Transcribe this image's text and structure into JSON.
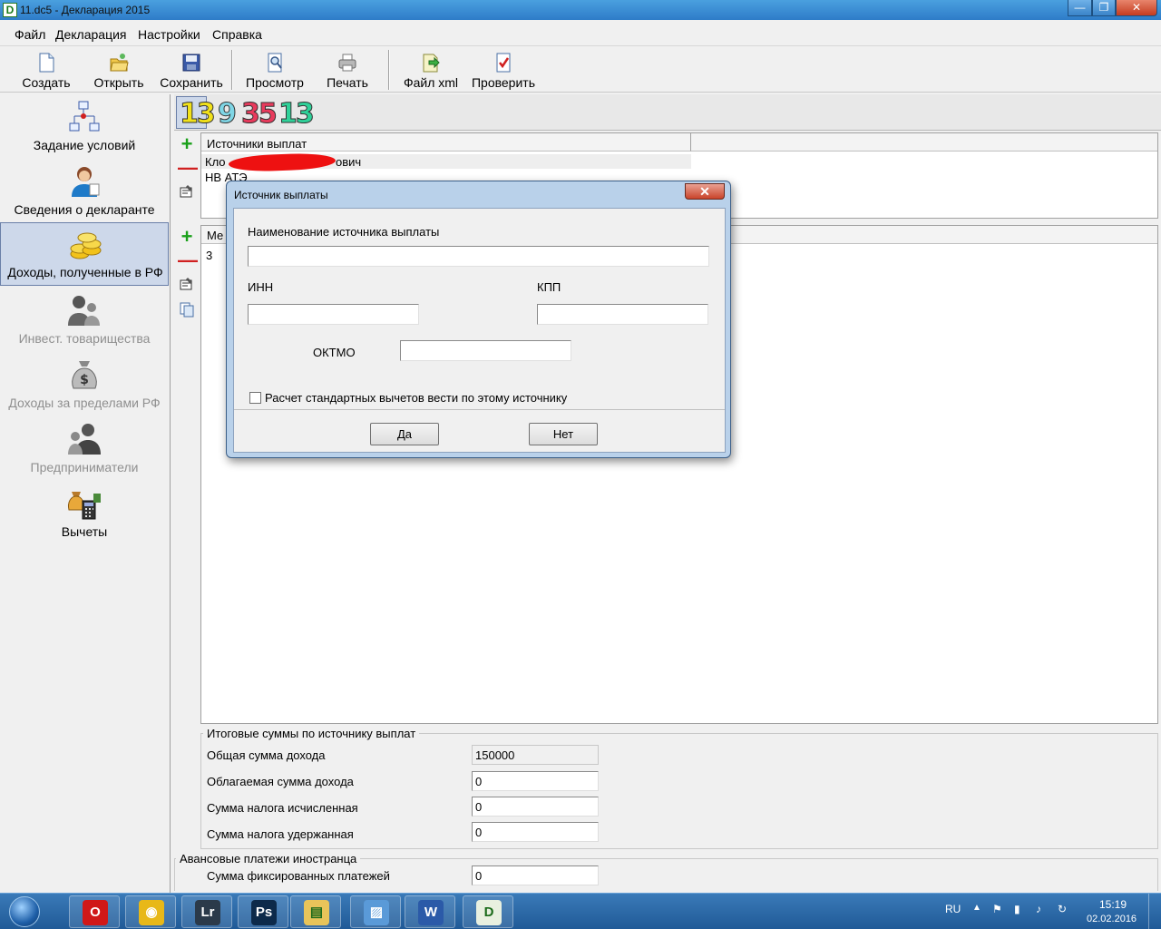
{
  "window": {
    "title": "11.dc5 - Декларация 2015",
    "app_icon": "D",
    "min_glyph": "—",
    "max_glyph": "❐",
    "close_glyph": "✕"
  },
  "menu": [
    "Файл",
    "Декларация",
    "Настройки",
    "Справка"
  ],
  "toolbar": {
    "create": "Создать",
    "open": "Открыть",
    "save": "Сохранить",
    "preview": "Просмотр",
    "print": "Печать",
    "xml": "Файл xml",
    "check": "Проверить"
  },
  "nav": {
    "conditions": "Задание условий",
    "declarant": "Сведения о декларанте",
    "income_rf": "Доходы, полученные в РФ",
    "invest": "Инвест. товарищества",
    "income_abroad": "Доходы за пределами РФ",
    "entrepreneurs": "Предприниматели",
    "deductions": "Вычеты"
  },
  "rates": [
    {
      "value": "13",
      "color": "#f2e21a"
    },
    {
      "value": "9",
      "color": "#7fd6e6"
    },
    {
      "value": "35",
      "color": "#e83a5c"
    },
    {
      "value": "13",
      "color": "#2fd199"
    }
  ],
  "sources": {
    "header": "Источники выплат",
    "rows": [
      "Кло",
      "ович",
      "НВ АТЭ"
    ]
  },
  "months": {
    "header": "Ме",
    "row1": "3"
  },
  "totals": {
    "title": "Итоговые суммы по источнику выплат",
    "total_income_label": "Общая сумма дохода",
    "total_income": "150000",
    "taxable_label": "Облагаемая сумма дохода",
    "taxable": "0",
    "tax_calc_label": "Сумма налога исчисленная",
    "tax_calc": "0",
    "tax_withheld_label": "Сумма налога удержанная",
    "tax_withheld": "0"
  },
  "advance": {
    "title": "Авансовые платежи иностранца",
    "fixed_label": "Сумма фиксированных платежей",
    "fixed": "0"
  },
  "dialog": {
    "title": "Источник выплаты",
    "close_glyph": "✕",
    "name_label": "Наименование источника выплаты",
    "name_value": "",
    "inn_label": "ИНН",
    "inn_value": "",
    "kpp_label": "КПП",
    "kpp_value": "",
    "oktmo_label": "ОКТМО",
    "oktmo_value": "",
    "std_deductions_label": "Расчет стандартных вычетов вести по этому источнику",
    "std_deductions_checked": false,
    "ok": "Да",
    "cancel": "Нет"
  },
  "taskbar": {
    "apps": [
      {
        "name": "opera-icon",
        "glyph": "O",
        "color": "#d01818"
      },
      {
        "name": "chrome-icon",
        "glyph": "◉",
        "color": "#e8b818"
      },
      {
        "name": "lightroom-icon",
        "glyph": "Lr",
        "color": "#2b3a4a"
      },
      {
        "name": "photoshop-icon",
        "glyph": "Ps",
        "color": "#0d2a4a"
      },
      {
        "name": "explorer-icon",
        "glyph": "▤",
        "color": "#e8c45a"
      },
      {
        "name": "photos-icon",
        "glyph": "▨",
        "color": "#5a9ad8"
      },
      {
        "name": "word-icon",
        "glyph": "W",
        "color": "#2b5aa8"
      },
      {
        "name": "declaration-icon",
        "glyph": "D",
        "color": "#e8f0e0"
      }
    ],
    "lang": "RU",
    "time": "15:19",
    "date": "02.02.2016"
  }
}
